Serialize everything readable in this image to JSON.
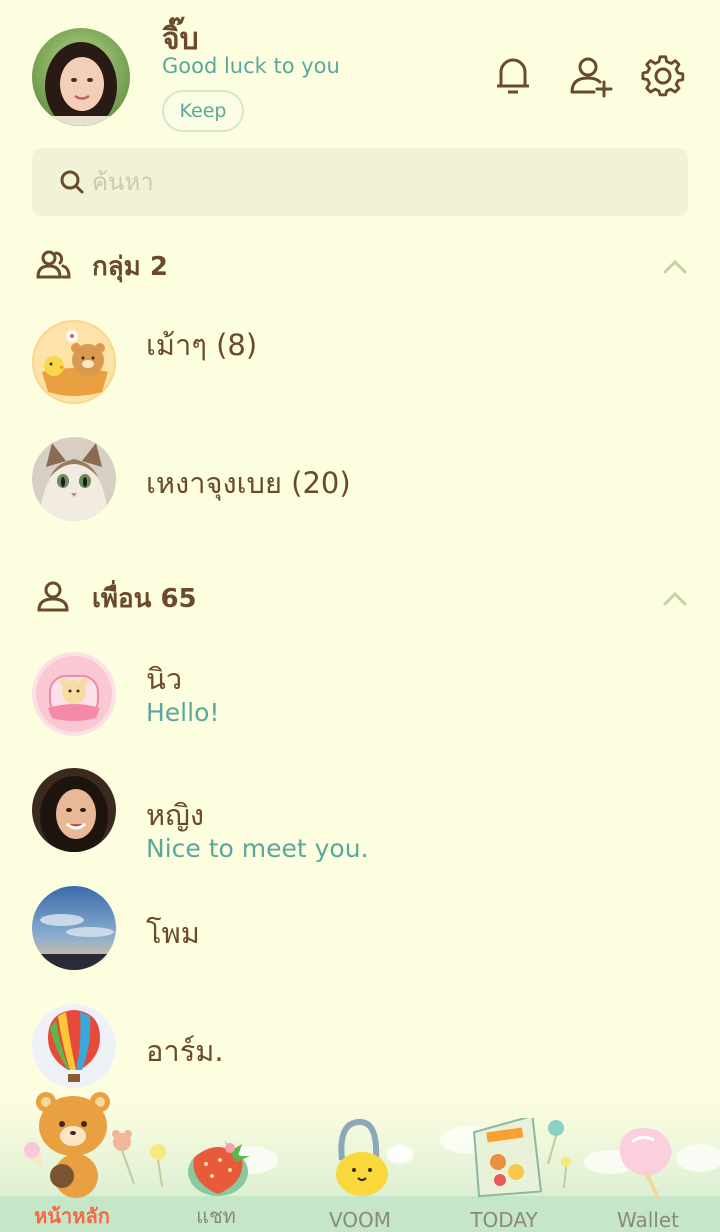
{
  "profile": {
    "name": "จิ๊บ",
    "status": "Good luck to you",
    "keep_label": "Keep"
  },
  "header_icons": [
    "bell-icon",
    "add-friend-icon",
    "settings-gear-icon"
  ],
  "search": {
    "placeholder": "ค้นหา"
  },
  "groups": {
    "title": "กลุ่ม 2",
    "items": [
      {
        "name": "เม้าๆ (8)",
        "avatar": "rilakkuma-bears-avatar"
      },
      {
        "name": "เหงาจุงเบย (20)",
        "avatar": "cat-avatar"
      }
    ]
  },
  "friends": {
    "title": "เพื่อน 65",
    "items": [
      {
        "name": "นิว",
        "message": "Hello!",
        "avatar": "rilakkuma-pink-avatar"
      },
      {
        "name": "หญิง",
        "message": "Nice to meet you.",
        "avatar": "woman-avatar"
      },
      {
        "name": "โพม",
        "message": "",
        "avatar": "sky-avatar"
      },
      {
        "name": "อาร์ม.",
        "message": "",
        "avatar": "balloon-avatar"
      }
    ]
  },
  "nav": {
    "items": [
      {
        "label": "หน้าหลัก",
        "icon": "rilakkuma-bear-icon",
        "active": true
      },
      {
        "label": "แชท",
        "icon": "strawberry-icon",
        "active": false
      },
      {
        "label": "VOOM",
        "icon": "yellow-bag-icon",
        "active": false
      },
      {
        "label": "TODAY",
        "icon": "cookie-bag-icon",
        "active": false
      },
      {
        "label": "Wallet",
        "icon": "cotton-candy-icon",
        "active": false
      }
    ]
  },
  "colors": {
    "background": "#fdfde0",
    "accent_teal": "#5aa89c",
    "text_brown": "#6a4a2c",
    "active_nav": "#f06a4a"
  }
}
